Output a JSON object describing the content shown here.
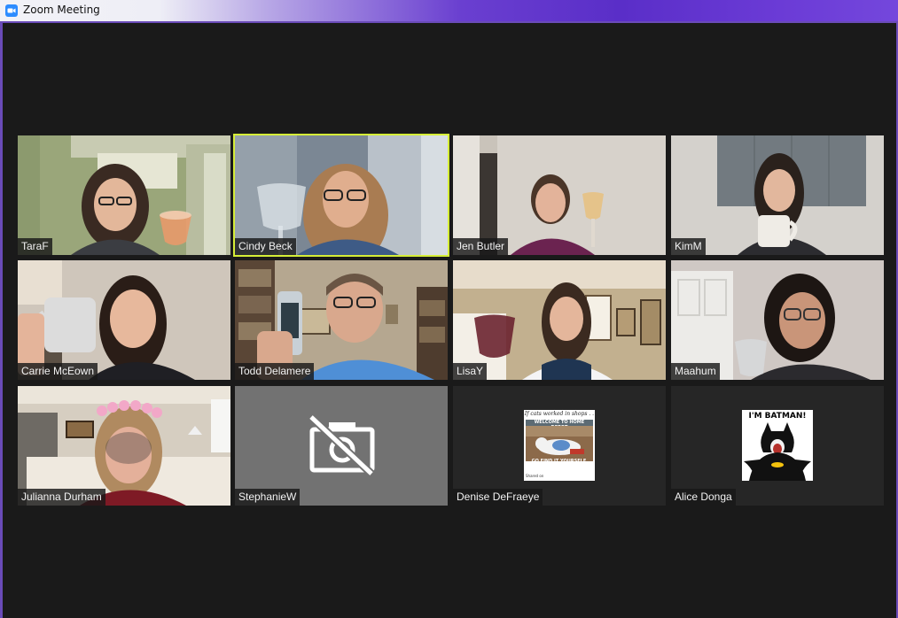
{
  "window": {
    "title": "Zoom Meeting",
    "icon": "zoom-camera-icon"
  },
  "participants": [
    {
      "name": "TaraF",
      "video": "on"
    },
    {
      "name": "Cindy Beck",
      "video": "on",
      "active_speaker": true
    },
    {
      "name": "Jen Butler",
      "video": "on"
    },
    {
      "name": "KimM",
      "video": "on"
    },
    {
      "name": "Carrie McEown",
      "video": "on"
    },
    {
      "name": "Todd Delamere",
      "video": "on"
    },
    {
      "name": "LisaY",
      "video": "on"
    },
    {
      "name": "Maahum",
      "video": "on"
    },
    {
      "name": "Julianna Durham",
      "video": "on"
    },
    {
      "name": "StephanieW",
      "video": "off",
      "icon": "camera-off-icon"
    },
    {
      "name": "Denise DeFraeye",
      "video": "off",
      "profile_picture": {
        "top_text": "If cats worked in shops . . .",
        "banner_text": "WELCOME TO HOME DEPOT",
        "bottom_text": "GO FIND IT YOURSELF.",
        "footer_text": "Shared on"
      }
    },
    {
      "name": "Alice Donga",
      "video": "off",
      "profile_picture": {
        "text": "I'M BATMAN!"
      }
    }
  ],
  "colors": {
    "active_speaker_border": "#d6ee37",
    "camera_off_tile": "#727272",
    "background": "#1a1a1a",
    "title_bar_accent": "#5a2ec8"
  }
}
